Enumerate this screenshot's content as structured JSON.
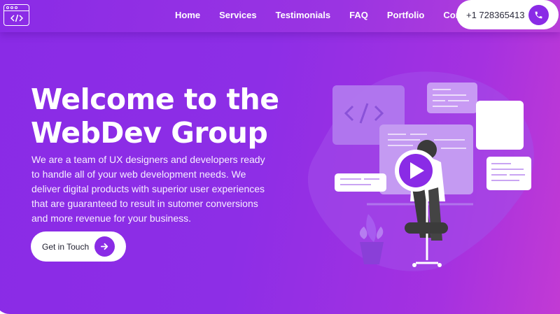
{
  "nav": {
    "logo_icon": "code-window-icon",
    "links": [
      {
        "label": "Home"
      },
      {
        "label": "Services"
      },
      {
        "label": "Testimonials"
      },
      {
        "label": "FAQ"
      },
      {
        "label": "Portfolio"
      },
      {
        "label": "Contact"
      }
    ],
    "phone": {
      "number": "+1 728365413",
      "icon": "phone-icon"
    }
  },
  "hero": {
    "title_line1": "Welcome to the",
    "title_line2": "WebDev Group",
    "description": "We are a team of UX designers and developers ready to handle all of your web development needs. We deliver digital products with superior user experiences that are guaranteed to result in sutomer conversions and more revenue for your business.",
    "cta_label": "Get in Touch",
    "cta_icon": "arrow-right-icon"
  },
  "colors": {
    "brand_purple": "#8a2be6",
    "gradient_end": "#c23ad4",
    "button_bg": "#ffffff"
  }
}
